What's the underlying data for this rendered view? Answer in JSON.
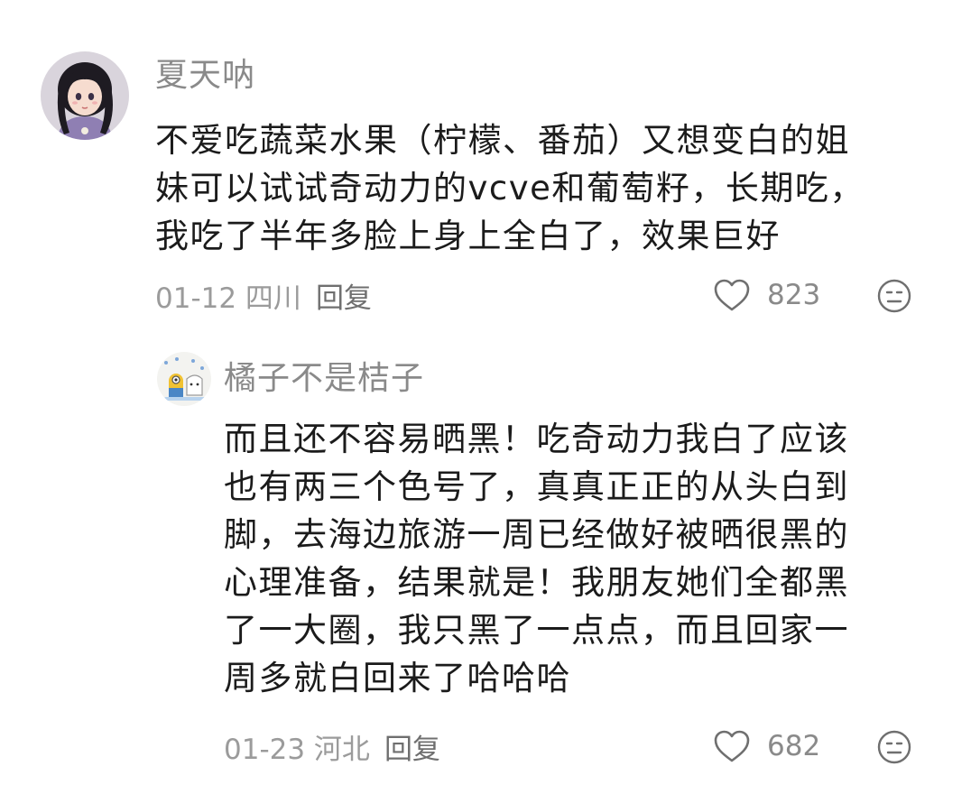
{
  "main_comment": {
    "username": "夏天呐",
    "body_lines": [
      "不爱吃蔬菜水果（柠檬、番茄）又想变白的姐",
      "妹可以试试奇动力的vcve和葡萄籽，长期吃，",
      "我吃了半年多脸上身上全白了，效果巨好"
    ],
    "date_location": "01-12 四川",
    "reply_label": "回复",
    "like_count": "823",
    "avatar_icon": "girl-avatar-icon",
    "like_icon": "heart-outline-icon",
    "dislike_icon": "unhappy-face-icon"
  },
  "reply_comment": {
    "username": "橘子不是桔子",
    "body_lines": [
      "而且还不容易晒黑！吃奇动力我白了应该",
      "也有两三个色号了，真真正正的从头白到",
      "脚，去海边旅游一周已经做好被晒很黑的",
      "心理准备，结果就是！我朋友她们全都黑",
      "了一大圈，我只黑了一点点，而且回家一",
      "周多就白回来了哈哈哈"
    ],
    "date_location": "01-23 河北",
    "reply_label": "回复",
    "like_count": "682",
    "avatar_icon": "cartoon-avatar-icon",
    "like_icon": "heart-outline-icon",
    "dislike_icon": "unhappy-face-icon"
  }
}
